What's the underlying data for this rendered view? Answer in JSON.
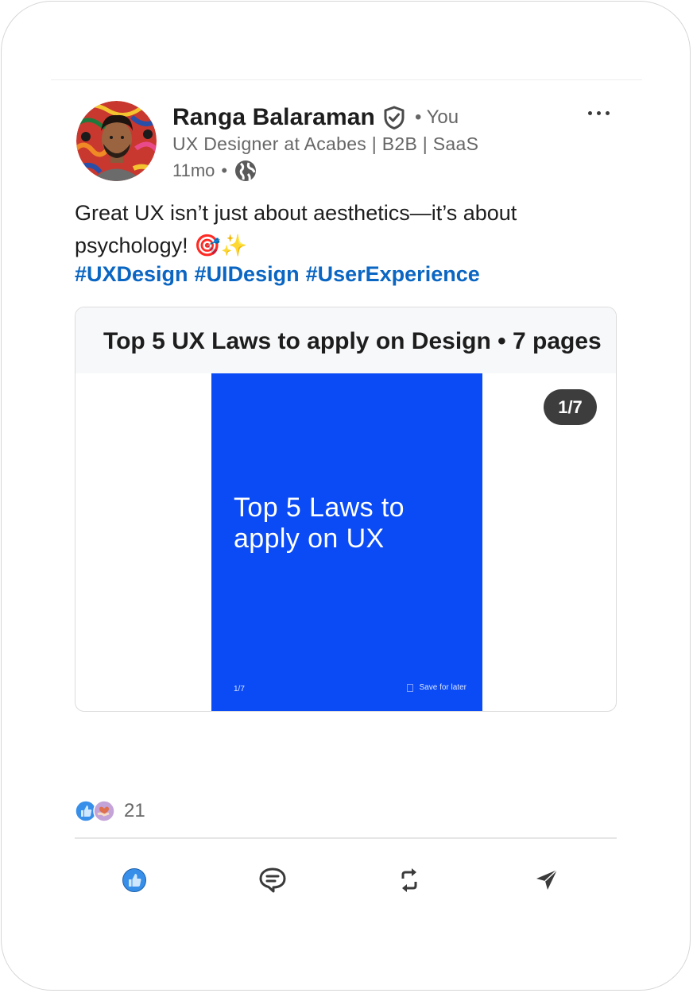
{
  "post": {
    "author": {
      "name": "Ranga Balaraman",
      "relation": "• You",
      "headline": "UX Designer at Acabes | B2B | SaaS",
      "time": "11mo",
      "time_separator": "•"
    },
    "text": "Great UX isn’t just about aesthetics—it’s about psychology! 🎯✨",
    "hashtags": [
      "#UXDesign",
      "#UIDesign",
      "#UserExperience"
    ]
  },
  "document": {
    "title": "Top 5 UX Laws to apply on Design • 7 pages",
    "page_counter": "1/7",
    "slide": {
      "title": "Top 5 Laws to apply on UX",
      "page_label": "1/7",
      "save_label": "Save for later"
    }
  },
  "reactions": {
    "count": "21",
    "types": [
      "like-icon",
      "love-icon"
    ]
  },
  "actions": [
    "like-icon",
    "comment-icon",
    "repost-icon",
    "send-icon"
  ],
  "colors": {
    "link": "#0a66c2",
    "slide_bg": "#0a4bf5",
    "counter_bg": "#3d3d3d",
    "like_blue": "#378fe9"
  }
}
